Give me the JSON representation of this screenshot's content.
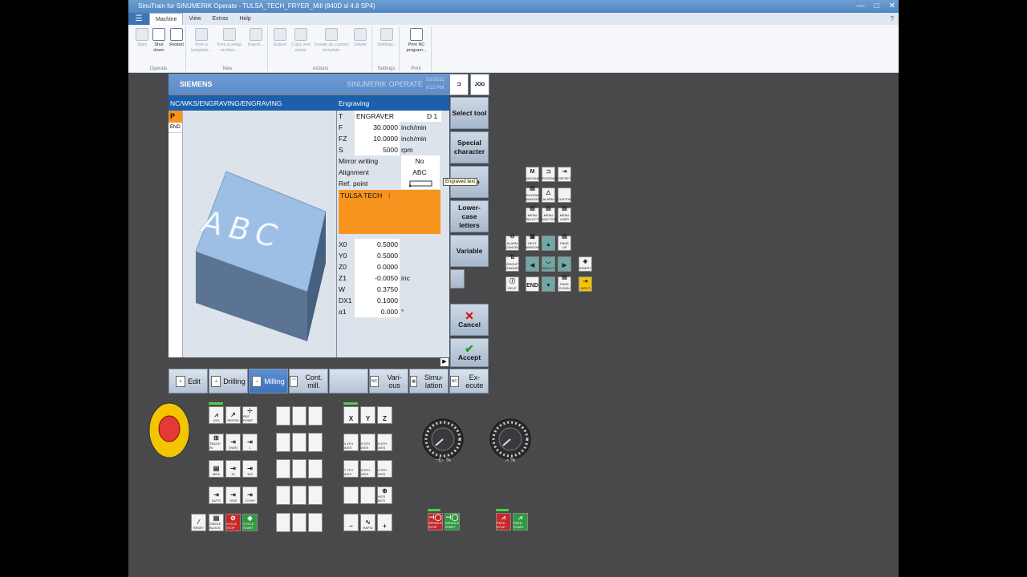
{
  "window": {
    "title": "SinuTrain for SINUMERIK Operate - TULSA_TECH_FRYER_Mill (840D sl 4.8 SP4)",
    "controls": [
      "—",
      "□",
      "✕"
    ]
  },
  "menu": {
    "hamburger": "☰",
    "items": [
      "Machine",
      "View",
      "Extras",
      "Help"
    ],
    "help_icon": "?"
  },
  "ribbon": {
    "groups": [
      {
        "label": "Operate",
        "buttons": [
          "Start",
          "Shut down",
          "Restart"
        ]
      },
      {
        "label": "New",
        "buttons": [
          "from a template...",
          "from a setup archive...",
          "Import..."
        ]
      },
      {
        "label": "Actions",
        "buttons": [
          "Export",
          "Copy and paste",
          "Create as custom template",
          "Delete"
        ]
      },
      {
        "label": "Settings",
        "buttons": [
          "Settings..."
        ]
      },
      {
        "label": "Print",
        "buttons": [
          "Print NC program..."
        ]
      }
    ]
  },
  "hmi": {
    "brand": "SIEMENS",
    "product": "SINUMERIK OPERATE",
    "date": "03/18/21",
    "time": "8:22 PM",
    "mode": "JOG",
    "path": "NC/WKS/ENGRAVING/ENGRAVING",
    "left_col": {
      "p": "P",
      "end": "END"
    },
    "block_text": "ABC",
    "dialog_title": "Engraving",
    "params": {
      "t_label": "T",
      "t_value": "ENGRAVER",
      "t_d": "D 1",
      "f_label": "F",
      "f_value": "30.0000",
      "f_unit": "inch/min",
      "fz_label": "FZ",
      "fz_value": "10.0000",
      "fz_unit": "inch/min",
      "s_label": "S",
      "s_value": "5000",
      "s_unit": "rpm",
      "mirror_label": "Mirror writing",
      "mirror_value": "No",
      "align_label": "Alignment",
      "align_value": "ABC",
      "ref_label": "Ref. point",
      "text": "TULSA TECH",
      "x0_label": "X0",
      "x0_value": "0.5000",
      "y0_label": "Y0",
      "y0_value": "0.5000",
      "z0_label": "Z0",
      "z0_value": "0.0000",
      "z1_label": "Z1",
      "z1_value": "-0.0050",
      "z1_unit": "inc",
      "w_label": "W",
      "w_value": "0.3750",
      "dx1_label": "DX1",
      "dx1_value": "0.1000",
      "a1_label": "α1",
      "a1_value": "0.000",
      "a1_unit": "°"
    },
    "tooltip": "Engraved text",
    "vsk": {
      "select_tool": "Select tool",
      "special_char": "Special character",
      "delete": "Delete",
      "lowercase": "Lower-case letters",
      "variable": "Variable",
      "cancel": "Cancel",
      "accept": "Accept"
    },
    "hsk": {
      "edit": "Edit",
      "drilling": "Drilling",
      "milling": "Milling",
      "cont_mill": "Cont. mill.",
      "various": "Vari- ous",
      "simulation": "Simu- lation",
      "execute": "Ex- ecute"
    }
  },
  "keypad": {
    "top": [
      [
        "MACHINE",
        "PROGRAM",
        "OFFSET"
      ],
      [
        "PROGRAM MANAGER",
        "ALARM",
        "CUSTOM"
      ],
      [
        "MENU SELECT",
        "MENU FUNCTION",
        "MENU USER"
      ]
    ],
    "nav": {
      "alarm_cancel": "ALARM CANCEL",
      "next_window": "NEXT WINDOW",
      "page_up": "PAGE UP",
      "group_channel": "GROUP CHANNEL",
      "select": "SELECT",
      "help": "HELP",
      "end": "END",
      "page_down": "PAGE DOWN",
      "insert": "INSERT",
      "input": "INPUT"
    }
  },
  "mcp": {
    "mode_keys": [
      "JOG",
      "REPOS",
      "REF POINT",
      "TEACH IN",
      "[VAR]",
      "1",
      "MDA",
      "10",
      "100",
      "AUTO",
      "1000",
      "10 000",
      "RESET",
      "SINGLE BLOCK",
      "CYCLE STOP",
      "CYCLE START"
    ],
    "axis_keys": [
      "X",
      "Y",
      "Z",
      "4 4TH AXIS",
      "5 5TH AXIS",
      "6 6TH AXIS",
      "7 7TH AXIS",
      "8 8TH AXIS",
      "9 9TH AXIS",
      "WCS MCS",
      "−",
      "RAPID",
      "+"
    ],
    "spindle": [
      "SPINDLE STOP",
      "SPINDLE START"
    ],
    "feed": [
      "FEED STOP",
      "FEED START"
    ]
  },
  "colors": {
    "accent": "#1b5fad",
    "highlight": "#f7941d",
    "estop": "#e53935"
  }
}
